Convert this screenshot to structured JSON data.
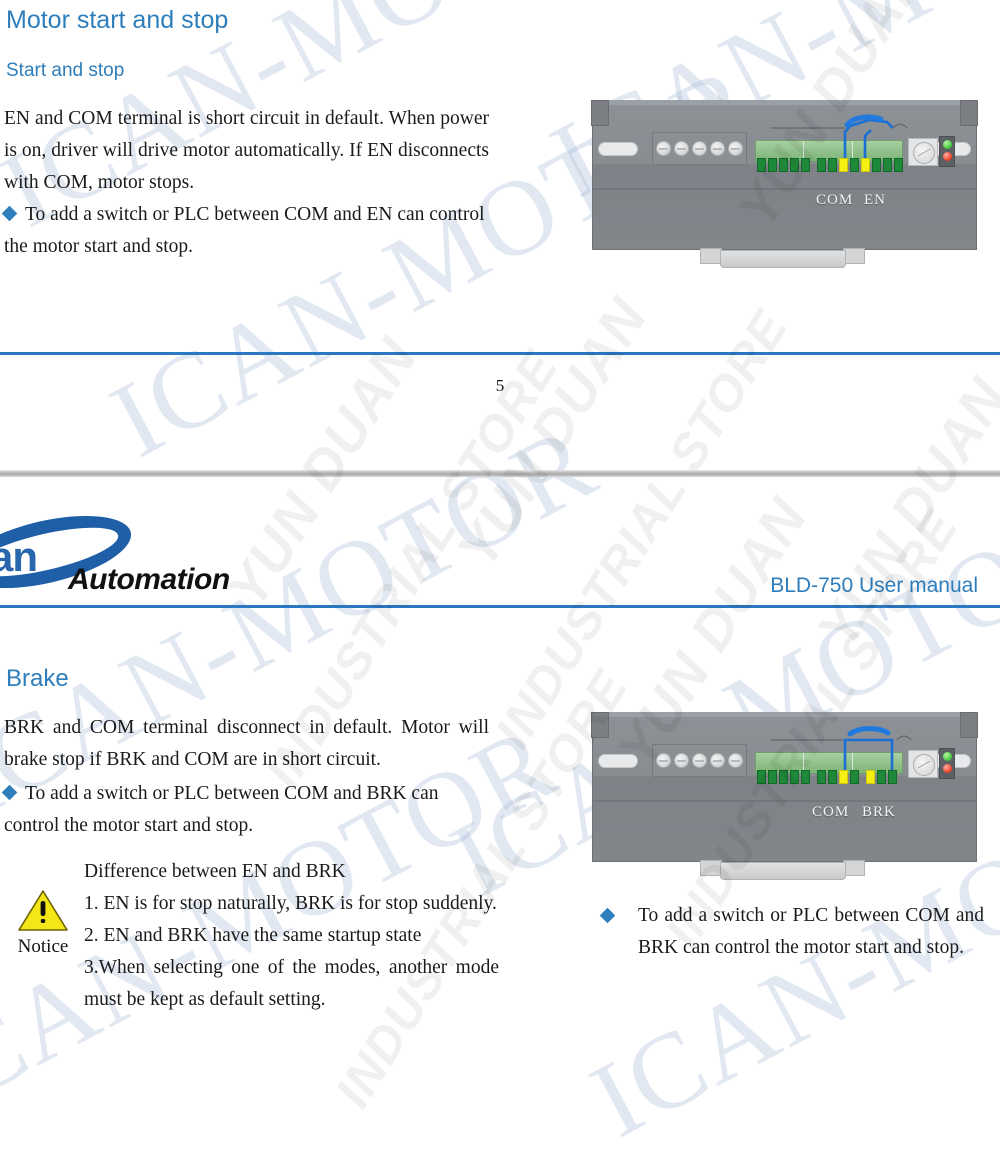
{
  "page1": {
    "heading": "Motor start and stop",
    "subheading": "Start and stop",
    "paragraph": "EN and COM terminal is short circuit in default. When power is on, driver will drive motor automatically. If EN disconnects with COM, motor stops.",
    "bullet": "To add a switch or PLC between COM and EN can control the motor start and stop.",
    "page_number": "5",
    "device": {
      "label_left": "COM",
      "label_right": "EN",
      "screw_count": 5,
      "pin_count": 14,
      "highlight_pins": [
        8,
        10
      ],
      "led_top": "green-led",
      "led_bottom": "red-led",
      "jumper": "blue-wire-arc"
    }
  },
  "page2": {
    "header": {
      "logo_text_main": "an",
      "logo_text_sub": "Automation",
      "title": "BLD-750  User manual"
    },
    "heading": "Brake",
    "paragraph": "BRK and COM terminal disconnect in default. Motor will brake stop if BRK and COM are in short circuit.",
    "bullet_left": "To add a switch or PLC between COM and BRK can control the motor start and stop.",
    "notice": {
      "label": "Notice",
      "line1": "Difference between EN and BRK",
      "line2": "1. EN is for stop naturally, BRK is for stop suddenly.",
      "line3": "2. EN and BRK have the same startup state",
      "line4": "3.When selecting one of the modes, another mode must be kept as default setting."
    },
    "bullet_right": "To add a switch or PLC between COM and BRK can control the motor start and stop.",
    "device": {
      "label_left": "COM",
      "label_right": "BRK",
      "screw_count": 5,
      "pin_count": 14,
      "highlight_pins": [
        7,
        9
      ],
      "led_top": "green-led",
      "led_bottom": "red-led",
      "jumper": "blue-wire-bracket"
    }
  },
  "watermarks": {
    "brand_blue": "ICAN-MOTOR",
    "store_line1": "YUN DUAN",
    "store_line2": "INDUSTRIAL STORE"
  },
  "colors": {
    "heading_blue": "#2e7ebb",
    "rule_blue": "#2b78c2",
    "bullet_blue": "#2e7ebb",
    "device_gray": "#888d92",
    "terminal_green": "#1e8a39",
    "terminal_highlight": "#f6ef12",
    "led_green": "#3cc83c",
    "led_red": "#ef3b22",
    "warning_yellow": "#f5e617"
  }
}
